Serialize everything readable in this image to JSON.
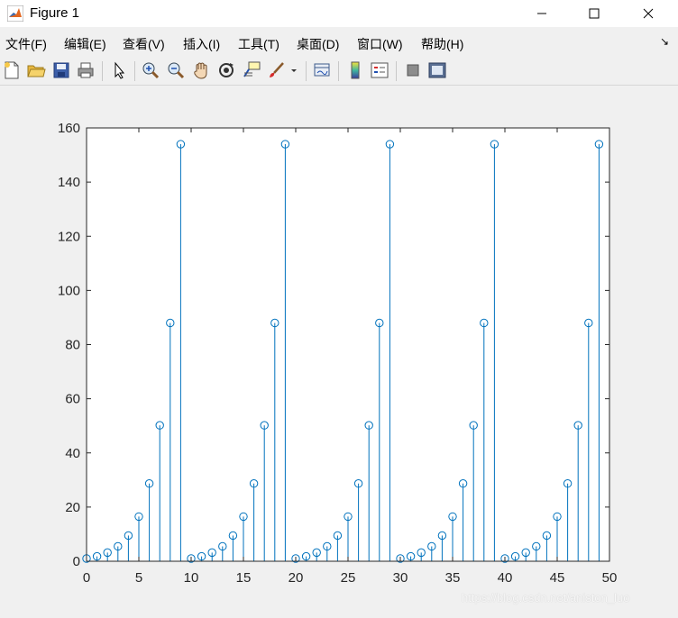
{
  "window": {
    "title": "Figure 1",
    "minimize_glyph": "—",
    "maximize_glyph": "☐",
    "close_glyph": "✕"
  },
  "menu": {
    "items": [
      "文件(F)",
      "编辑(E)",
      "查看(V)",
      "插入(I)",
      "工具(T)",
      "桌面(D)",
      "窗口(W)",
      "帮助(H)"
    ],
    "more_glyph": "↘"
  },
  "toolbar": {
    "icons": [
      "new-figure-icon",
      "open-file-icon",
      "save-icon",
      "print-icon",
      "select-arrow-icon",
      "zoom-in-icon",
      "zoom-out-icon",
      "pan-hand-icon",
      "rotate-3d-icon",
      "data-cursor-icon",
      "brush-icon",
      "link-plot-icon",
      "colorbar-icon",
      "legend-icon",
      "hide-plot-tools-icon",
      "show-plot-tools-icon"
    ]
  },
  "colors": {
    "stem": "#0072bd",
    "axes": "#262626",
    "background": "#f0f0f0",
    "plot_background": "#ffffff"
  },
  "watermark": "https://blog.csdn.net/aniston_luo",
  "chart_data": {
    "type": "stem",
    "title": "",
    "xlabel": "",
    "ylabel": "",
    "xlim": [
      0,
      50
    ],
    "ylim": [
      0,
      160
    ],
    "xticks": [
      0,
      5,
      10,
      15,
      20,
      25,
      30,
      35,
      40,
      45,
      50
    ],
    "yticks": [
      0,
      20,
      40,
      60,
      80,
      100,
      120,
      140,
      160
    ],
    "grid": false,
    "legend": "none",
    "x": [
      0,
      1,
      2,
      3,
      4,
      5,
      6,
      7,
      8,
      9,
      10,
      11,
      12,
      13,
      14,
      15,
      16,
      17,
      18,
      19,
      20,
      21,
      22,
      23,
      24,
      25,
      26,
      27,
      28,
      29,
      30,
      31,
      32,
      33,
      34,
      35,
      36,
      37,
      38,
      39,
      40,
      41,
      42,
      43,
      44,
      45,
      46,
      47,
      48,
      49
    ],
    "y": [
      1.0,
      1.8,
      3.2,
      5.5,
      9.5,
      16.5,
      28.7,
      50.2,
      88.0,
      154.0,
      1.0,
      1.8,
      3.2,
      5.5,
      9.5,
      16.5,
      28.7,
      50.2,
      88.0,
      154.0,
      1.0,
      1.8,
      3.2,
      5.5,
      9.5,
      16.5,
      28.7,
      50.2,
      88.0,
      154.0,
      1.0,
      1.8,
      3.2,
      5.5,
      9.5,
      16.5,
      28.7,
      50.2,
      88.0,
      154.0,
      1.0,
      1.8,
      3.2,
      5.5,
      9.5,
      16.5,
      28.7,
      50.2,
      88.0,
      154.0
    ]
  }
}
